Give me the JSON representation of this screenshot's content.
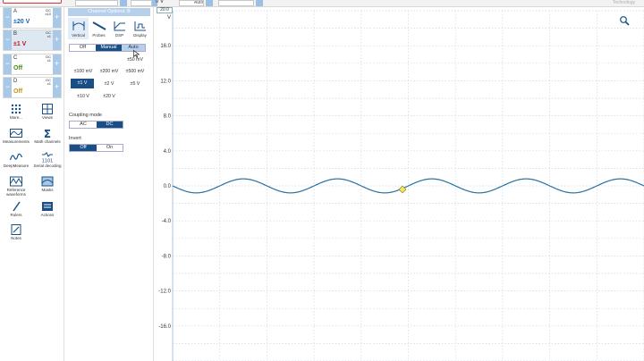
{
  "channels": [
    {
      "letter": "A",
      "range": "±20 V",
      "coupling": "DC",
      "probe": "x10",
      "color": "#1a5fb4",
      "selected": false
    },
    {
      "letter": "B",
      "range": "±1 V",
      "coupling": "DC",
      "probe": "x1",
      "color": "#c0141c",
      "selected": true
    },
    {
      "letter": "C",
      "range": "Off",
      "coupling": "DC",
      "probe": "x1",
      "color": "#4a8a14",
      "selected": false
    },
    {
      "letter": "D",
      "range": "Off",
      "coupling": "DC",
      "probe": "x1",
      "color": "#c89414",
      "selected": false
    }
  ],
  "tools": [
    {
      "label": "More...",
      "icon": "grid-icon"
    },
    {
      "label": "Views",
      "icon": "views-icon"
    },
    {
      "label": "Measurements",
      "icon": "measurements-icon"
    },
    {
      "label": "Math channels",
      "icon": "sigma-icon"
    },
    {
      "label": "DeepMeasure",
      "icon": "deepmeasure-icon"
    },
    {
      "label": "Serial decoding",
      "icon": "serial-decoding-icon"
    },
    {
      "label": "Reference waveforms",
      "icon": "reference-waveforms-icon"
    },
    {
      "label": "Masks",
      "icon": "masks-icon"
    },
    {
      "label": "Rulers",
      "icon": "rulers-icon"
    },
    {
      "label": "Actions",
      "icon": "actions-icon"
    },
    {
      "label": "Notes",
      "icon": "notes-icon"
    }
  ],
  "panel": {
    "title": "Channel Options: B",
    "tabs": [
      "Vertical",
      "Probes",
      "DSP",
      "Display"
    ],
    "mode_buttons": [
      "Off",
      "Manual",
      "Auto"
    ],
    "mode_selected": "Manual",
    "ranges": {
      "row1": [
        "±50 mV"
      ],
      "row2": [
        "±100 mV",
        "±200 mV",
        "±500 mV"
      ],
      "row3": [
        "±1 V",
        "±2 V",
        "±5 V"
      ],
      "row4": [
        "±10 V",
        "±20 V"
      ]
    },
    "range_selected": "±1 V",
    "coupling_label": "Coupling mode",
    "coupling_buttons": [
      "AC",
      "DC"
    ],
    "coupling_selected": "DC",
    "invert_label": "Invert",
    "invert_buttons": [
      "Off",
      "On"
    ],
    "invert_selected": "Off"
  },
  "topbar": {
    "auto_label": "Auto",
    "brand": "Technology",
    "offset_label": "0 V"
  },
  "plot": {
    "y_unit": "V",
    "y_ticks": [
      "16.0",
      "12.0",
      "8.0",
      "4.0",
      "0.0",
      "-4.0",
      "-8.0",
      "-12.0",
      "-16.0"
    ],
    "y_range": [
      -20,
      20
    ],
    "trace_color": "#2a6f9e",
    "amplitude_v": 0.8,
    "cycles": 5,
    "ruler_value": "20.0",
    "zoom_icon": "zoom-icon"
  }
}
